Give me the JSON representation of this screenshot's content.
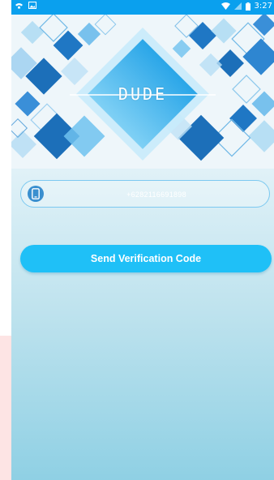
{
  "app": {
    "logo_text": "DUDE"
  },
  "status_bar": {
    "time": "3:27",
    "icons": [
      "notification-icon",
      "image-icon",
      "wifi-icon",
      "no-signal-icon",
      "battery-icon"
    ]
  },
  "phone_field": {
    "value": "+6282116691898",
    "icon": "phone-icon"
  },
  "send_button": {
    "label": "Send Verification Code"
  },
  "colors": {
    "status_bar": "#0aa0ee",
    "accent": "#1fc0f7",
    "field_border": "#7cc9f0",
    "side_strip": "#fde4e4"
  }
}
